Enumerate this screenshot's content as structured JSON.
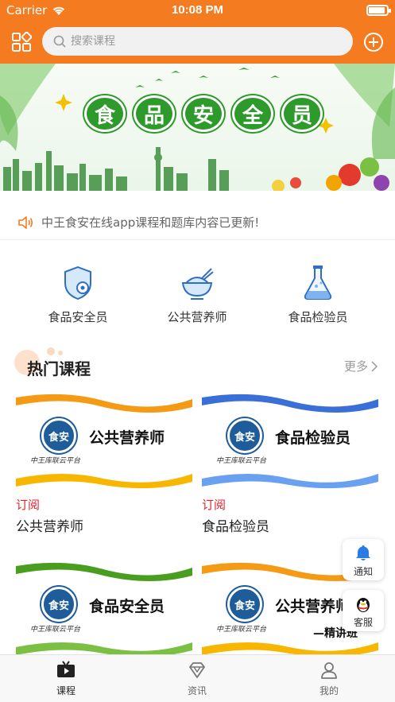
{
  "status_bar": {
    "carrier": "Carrier",
    "time": "10:08 PM"
  },
  "header": {
    "search_placeholder": "搜索课程"
  },
  "banner": {
    "title_chars": [
      "食",
      "品",
      "安",
      "全",
      "员"
    ]
  },
  "notice": {
    "text": "中王食安在线app课程和题库内容已更新!"
  },
  "categories": [
    {
      "label": "食品安全员",
      "icon": "shield-gear-icon"
    },
    {
      "label": "公共营养师",
      "icon": "rice-bowl-icon"
    },
    {
      "label": "食品检验员",
      "icon": "flask-icon"
    }
  ],
  "section": {
    "title": "热门课程",
    "more": "更多"
  },
  "courses": [
    {
      "thumb_title": "公共营养师",
      "tag": "订阅",
      "name": "公共营养师",
      "stripe_top": "#f59a14",
      "stripe_bottom": "#f7b700"
    },
    {
      "thumb_title": "食品检验员",
      "tag": "订阅",
      "name": "食品检验员",
      "stripe_top": "#3a6fd8",
      "stripe_bottom": "#6aa0f0"
    },
    {
      "thumb_title": "食品安全员",
      "stripe_top": "#4a9e1f",
      "stripe_bottom": "#7bc043"
    },
    {
      "thumb_title": "公共营养师",
      "thumb_note": "—精讲班",
      "stripe_top": "#f59a14",
      "stripe_bottom": "#f7b700"
    }
  ],
  "logo": {
    "text": "食安",
    "caption": "中王库联云平台"
  },
  "floating": {
    "notify": "通知",
    "service": "客服"
  },
  "tabbar": [
    {
      "label": "课程",
      "icon": "play-video-icon",
      "active": true
    },
    {
      "label": "资讯",
      "icon": "diamond-icon",
      "active": false
    },
    {
      "label": "我的",
      "icon": "user-icon",
      "active": false
    }
  ],
  "colors": {
    "accent": "#f47b20",
    "tag_red": "#e0242f",
    "banner_green": "#2f9a2c"
  }
}
